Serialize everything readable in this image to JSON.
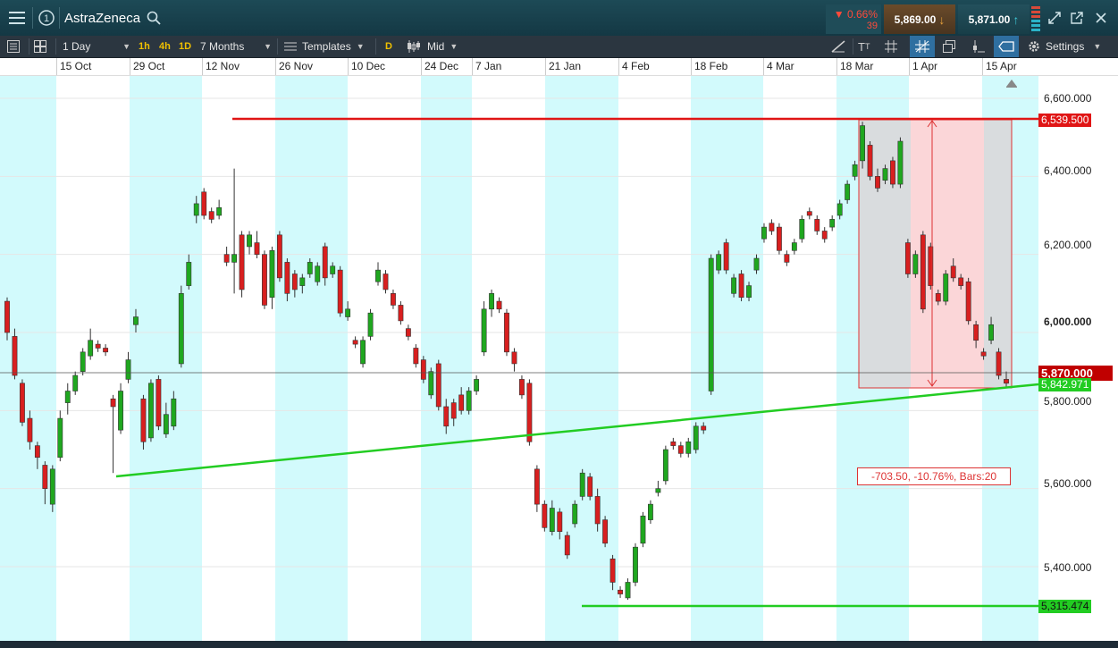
{
  "app": {
    "title": "AstraZeneca"
  },
  "header": {
    "menu_icon": "hamburger-menu-icon",
    "info_icon": "circled-one-icon",
    "search_icon": "search-icon",
    "change_pct": "▼ 0.66%",
    "change_pts": "39",
    "sell_price": "5,869.00",
    "buy_price": "5,871.00",
    "sell_arrow": "down-arrow-icon",
    "buy_arrow": "up-arrow-icon"
  },
  "toolbar": {
    "interval": "1 Day",
    "quick_intervals": [
      "1h",
      "4h",
      "1D"
    ],
    "range": "7 Months",
    "templates": "Templates",
    "d_label": "D",
    "price_type": "Mid",
    "settings": "Settings"
  },
  "time_axis": [
    "15 Oct",
    "29 Oct",
    "12 Nov",
    "26 Nov",
    "10 Dec",
    "24 Dec",
    "7 Jan",
    "21 Jan",
    "4 Feb",
    "18 Feb",
    "4 Mar",
    "18 Mar",
    "1 Apr",
    "15 Apr"
  ],
  "price_axis": [
    "6,600.000",
    "6,400.000",
    "6,200.000",
    "6,000.000",
    "5,800.000",
    "5,600.000",
    "5,400.000"
  ],
  "tags": {
    "resistance": "6,539.500",
    "current": "5,870.000",
    "trendline": "5,842.971",
    "support": "5,315.474"
  },
  "measure_label": "-703.50, -10.76%, Bars:20",
  "colors": {
    "up": "#1fa71f",
    "down": "#d81f1f",
    "band": "#d2fafc",
    "resistance": "#e01515",
    "support": "#22cc22",
    "current": "#c00000"
  },
  "chart_data": {
    "type": "candlestick",
    "title": "AstraZeneca",
    "ylim": [
      5250,
      6650
    ],
    "x_ticks": [
      "15 Oct",
      "29 Oct",
      "12 Nov",
      "26 Nov",
      "10 Dec",
      "24 Dec",
      "7 Jan",
      "21 Jan",
      "4 Feb",
      "18 Feb",
      "4 Mar",
      "18 Mar",
      "1 Apr",
      "15 Apr"
    ],
    "y_ticks": [
      6600,
      6400,
      6200,
      6000,
      5800,
      5600,
      5400
    ],
    "lines": {
      "resistance": 6539.5,
      "current": 5870.0,
      "support": 5315.474,
      "trendline_end": 5842.971
    },
    "measurement": {
      "change": -703.5,
      "change_pct": -10.76,
      "bars": 20
    },
    "candles": [
      {
        "o": 6080,
        "c": 6000,
        "h": 6090,
        "l": 5980
      },
      {
        "o": 5990,
        "c": 5890,
        "h": 6010,
        "l": 5880
      },
      {
        "o": 5870,
        "c": 5770,
        "h": 5880,
        "l": 5760
      },
      {
        "o": 5780,
        "c": 5720,
        "h": 5800,
        "l": 5700
      },
      {
        "o": 5710,
        "c": 5680,
        "h": 5720,
        "l": 5650
      },
      {
        "o": 5660,
        "c": 5600,
        "h": 5670,
        "l": 5560
      },
      {
        "o": 5560,
        "c": 5650,
        "h": 5660,
        "l": 5540
      },
      {
        "o": 5680,
        "c": 5780,
        "h": 5800,
        "l": 5670
      },
      {
        "o": 5820,
        "c": 5850,
        "h": 5870,
        "l": 5790
      },
      {
        "o": 5850,
        "c": 5890,
        "h": 5900,
        "l": 5840
      },
      {
        "o": 5900,
        "c": 5950,
        "h": 5960,
        "l": 5890
      },
      {
        "o": 5940,
        "c": 5980,
        "h": 6010,
        "l": 5930
      },
      {
        "o": 5970,
        "c": 5960,
        "h": 5980,
        "l": 5950
      },
      {
        "o": 5960,
        "c": 5950,
        "h": 5970,
        "l": 5940
      },
      {
        "o": 5830,
        "c": 5810,
        "h": 5840,
        "l": 5640
      },
      {
        "o": 5750,
        "c": 5850,
        "h": 5870,
        "l": 5740
      },
      {
        "o": 5880,
        "c": 5930,
        "h": 5950,
        "l": 5870
      },
      {
        "o": 6020,
        "c": 6040,
        "h": 6060,
        "l": 6000
      },
      {
        "o": 5830,
        "c": 5720,
        "h": 5840,
        "l": 5700
      },
      {
        "o": 5730,
        "c": 5870,
        "h": 5880,
        "l": 5720
      },
      {
        "o": 5880,
        "c": 5760,
        "h": 5890,
        "l": 5750
      },
      {
        "o": 5740,
        "c": 5790,
        "h": 5820,
        "l": 5730
      },
      {
        "o": 5760,
        "c": 5830,
        "h": 5850,
        "l": 5750
      },
      {
        "o": 5920,
        "c": 6100,
        "h": 6120,
        "l": 5910
      },
      {
        "o": 6120,
        "c": 6180,
        "h": 6200,
        "l": 6110
      },
      {
        "o": 6300,
        "c": 6330,
        "h": 6350,
        "l": 6280
      },
      {
        "o": 6360,
        "c": 6300,
        "h": 6370,
        "l": 6290
      },
      {
        "o": 6310,
        "c": 6290,
        "h": 6320,
        "l": 6280
      },
      {
        "o": 6300,
        "c": 6320,
        "h": 6340,
        "l": 6290
      },
      {
        "o": 6200,
        "c": 6180,
        "h": 6220,
        "l": 6170
      },
      {
        "o": 6180,
        "c": 6200,
        "h": 6420,
        "l": 6100
      },
      {
        "o": 6250,
        "c": 6110,
        "h": 6260,
        "l": 6090
      },
      {
        "o": 6220,
        "c": 6250,
        "h": 6260,
        "l": 6200
      },
      {
        "o": 6230,
        "c": 6200,
        "h": 6260,
        "l": 6190
      },
      {
        "o": 6200,
        "c": 6070,
        "h": 6210,
        "l": 6060
      },
      {
        "o": 6090,
        "c": 6210,
        "h": 6220,
        "l": 6060
      },
      {
        "o": 6250,
        "c": 6140,
        "h": 6260,
        "l": 6130
      },
      {
        "o": 6180,
        "c": 6100,
        "h": 6190,
        "l": 6080
      },
      {
        "o": 6150,
        "c": 6110,
        "h": 6160,
        "l": 6090
      },
      {
        "o": 6120,
        "c": 6140,
        "h": 6150,
        "l": 6100
      },
      {
        "o": 6150,
        "c": 6180,
        "h": 6190,
        "l": 6140
      },
      {
        "o": 6130,
        "c": 6170,
        "h": 6180,
        "l": 6120
      },
      {
        "o": 6220,
        "c": 6140,
        "h": 6230,
        "l": 6120
      },
      {
        "o": 6150,
        "c": 6170,
        "h": 6180,
        "l": 6140
      },
      {
        "o": 6160,
        "c": 6050,
        "h": 6170,
        "l": 6040
      },
      {
        "o": 6040,
        "c": 6060,
        "h": 6080,
        "l": 6030
      },
      {
        "o": 5980,
        "c": 5970,
        "h": 5990,
        "l": 5960
      },
      {
        "o": 5920,
        "c": 5980,
        "h": 5990,
        "l": 5910
      },
      {
        "o": 5990,
        "c": 6050,
        "h": 6060,
        "l": 5980
      },
      {
        "o": 6130,
        "c": 6160,
        "h": 6180,
        "l": 6120
      },
      {
        "o": 6150,
        "c": 6110,
        "h": 6160,
        "l": 6100
      },
      {
        "o": 6100,
        "c": 6070,
        "h": 6110,
        "l": 6060
      },
      {
        "o": 6070,
        "c": 6030,
        "h": 6080,
        "l": 6020
      },
      {
        "o": 6010,
        "c": 5990,
        "h": 6020,
        "l": 5980
      },
      {
        "o": 5960,
        "c": 5920,
        "h": 5970,
        "l": 5910
      },
      {
        "o": 5930,
        "c": 5880,
        "h": 5940,
        "l": 5870
      },
      {
        "o": 5840,
        "c": 5900,
        "h": 5910,
        "l": 5830
      },
      {
        "o": 5920,
        "c": 5810,
        "h": 5930,
        "l": 5800
      },
      {
        "o": 5810,
        "c": 5760,
        "h": 5830,
        "l": 5740
      },
      {
        "o": 5820,
        "c": 5780,
        "h": 5830,
        "l": 5760
      },
      {
        "o": 5840,
        "c": 5800,
        "h": 5860,
        "l": 5790
      },
      {
        "o": 5800,
        "c": 5850,
        "h": 5860,
        "l": 5790
      },
      {
        "o": 5850,
        "c": 5880,
        "h": 5890,
        "l": 5840
      },
      {
        "o": 5950,
        "c": 6060,
        "h": 6080,
        "l": 5940
      },
      {
        "o": 6060,
        "c": 6100,
        "h": 6110,
        "l": 6040
      },
      {
        "o": 6080,
        "c": 6060,
        "h": 6090,
        "l": 6050
      },
      {
        "o": 6050,
        "c": 5950,
        "h": 6060,
        "l": 5940
      },
      {
        "o": 5950,
        "c": 5920,
        "h": 5960,
        "l": 5900
      },
      {
        "o": 5880,
        "c": 5840,
        "h": 5890,
        "l": 5830
      },
      {
        "o": 5870,
        "c": 5720,
        "h": 5880,
        "l": 5710
      },
      {
        "o": 5650,
        "c": 5560,
        "h": 5660,
        "l": 5540
      },
      {
        "o": 5560,
        "c": 5500,
        "h": 5570,
        "l": 5490
      },
      {
        "o": 5490,
        "c": 5550,
        "h": 5570,
        "l": 5480
      },
      {
        "o": 5540,
        "c": 5490,
        "h": 5550,
        "l": 5470
      },
      {
        "o": 5480,
        "c": 5430,
        "h": 5490,
        "l": 5420
      },
      {
        "o": 5510,
        "c": 5560,
        "h": 5570,
        "l": 5500
      },
      {
        "o": 5580,
        "c": 5640,
        "h": 5650,
        "l": 5570
      },
      {
        "o": 5630,
        "c": 5580,
        "h": 5640,
        "l": 5570
      },
      {
        "o": 5580,
        "c": 5510,
        "h": 5600,
        "l": 5490
      },
      {
        "o": 5520,
        "c": 5460,
        "h": 5530,
        "l": 5450
      },
      {
        "o": 5420,
        "c": 5360,
        "h": 5430,
        "l": 5340
      },
      {
        "o": 5340,
        "c": 5330,
        "h": 5350,
        "l": 5320
      },
      {
        "o": 5320,
        "c": 5360,
        "h": 5370,
        "l": 5315
      },
      {
        "o": 5360,
        "c": 5450,
        "h": 5460,
        "l": 5350
      },
      {
        "o": 5460,
        "c": 5530,
        "h": 5540,
        "l": 5450
      },
      {
        "o": 5520,
        "c": 5560,
        "h": 5570,
        "l": 5510
      },
      {
        "o": 5590,
        "c": 5600,
        "h": 5620,
        "l": 5580
      },
      {
        "o": 5620,
        "c": 5700,
        "h": 5710,
        "l": 5610
      },
      {
        "o": 5720,
        "c": 5710,
        "h": 5730,
        "l": 5700
      },
      {
        "o": 5710,
        "c": 5690,
        "h": 5720,
        "l": 5680
      },
      {
        "o": 5690,
        "c": 5720,
        "h": 5730,
        "l": 5680
      },
      {
        "o": 5700,
        "c": 5760,
        "h": 5770,
        "l": 5690
      },
      {
        "o": 5760,
        "c": 5750,
        "h": 5770,
        "l": 5740
      },
      {
        "o": 5850,
        "c": 6190,
        "h": 6200,
        "l": 5840
      },
      {
        "o": 6160,
        "c": 6200,
        "h": 6210,
        "l": 6150
      },
      {
        "o": 6230,
        "c": 6160,
        "h": 6240,
        "l": 6150
      },
      {
        "o": 6100,
        "c": 6140,
        "h": 6150,
        "l": 6090
      },
      {
        "o": 6150,
        "c": 6090,
        "h": 6160,
        "l": 6080
      },
      {
        "o": 6090,
        "c": 6120,
        "h": 6130,
        "l": 6080
      },
      {
        "o": 6160,
        "c": 6190,
        "h": 6200,
        "l": 6150
      },
      {
        "o": 6240,
        "c": 6270,
        "h": 6280,
        "l": 6230
      },
      {
        "o": 6280,
        "c": 6260,
        "h": 6290,
        "l": 6250
      },
      {
        "o": 6270,
        "c": 6210,
        "h": 6280,
        "l": 6200
      },
      {
        "o": 6200,
        "c": 6180,
        "h": 6210,
        "l": 6170
      },
      {
        "o": 6210,
        "c": 6230,
        "h": 6240,
        "l": 6200
      },
      {
        "o": 6240,
        "c": 6290,
        "h": 6300,
        "l": 6230
      },
      {
        "o": 6310,
        "c": 6300,
        "h": 6320,
        "l": 6290
      },
      {
        "o": 6290,
        "c": 6260,
        "h": 6300,
        "l": 6250
      },
      {
        "o": 6260,
        "c": 6240,
        "h": 6270,
        "l": 6230
      },
      {
        "o": 6270,
        "c": 6290,
        "h": 6300,
        "l": 6260
      },
      {
        "o": 6300,
        "c": 6330,
        "h": 6340,
        "l": 6290
      },
      {
        "o": 6340,
        "c": 6380,
        "h": 6390,
        "l": 6330
      },
      {
        "o": 6400,
        "c": 6430,
        "h": 6440,
        "l": 6390
      },
      {
        "o": 6440,
        "c": 6530,
        "h": 6540,
        "l": 6420
      },
      {
        "o": 6480,
        "c": 6400,
        "h": 6490,
        "l": 6390
      },
      {
        "o": 6400,
        "c": 6370,
        "h": 6420,
        "l": 6360
      },
      {
        "o": 6390,
        "c": 6420,
        "h": 6430,
        "l": 6380
      },
      {
        "o": 6440,
        "c": 6380,
        "h": 6450,
        "l": 6370
      },
      {
        "o": 6380,
        "c": 6490,
        "h": 6500,
        "l": 6370
      },
      {
        "o": 6230,
        "c": 6150,
        "h": 6240,
        "l": 6140
      },
      {
        "o": 6150,
        "c": 6200,
        "h": 6210,
        "l": 6140
      },
      {
        "o": 6250,
        "c": 6060,
        "h": 6260,
        "l": 6050
      },
      {
        "o": 6220,
        "c": 6120,
        "h": 6230,
        "l": 6110
      },
      {
        "o": 6100,
        "c": 6080,
        "h": 6110,
        "l": 6070
      },
      {
        "o": 6080,
        "c": 6150,
        "h": 6160,
        "l": 6070
      },
      {
        "o": 6170,
        "c": 6140,
        "h": 6190,
        "l": 6130
      },
      {
        "o": 6140,
        "c": 6120,
        "h": 6150,
        "l": 6110
      },
      {
        "o": 6130,
        "c": 6030,
        "h": 6140,
        "l": 6020
      },
      {
        "o": 6020,
        "c": 5980,
        "h": 6030,
        "l": 5960
      },
      {
        "o": 5950,
        "c": 5940,
        "h": 5960,
        "l": 5930
      },
      {
        "o": 5980,
        "c": 6020,
        "h": 6040,
        "l": 5970
      },
      {
        "o": 5950,
        "c": 5890,
        "h": 5960,
        "l": 5880
      },
      {
        "o": 5880,
        "c": 5870,
        "h": 5900,
        "l": 5860
      }
    ]
  }
}
